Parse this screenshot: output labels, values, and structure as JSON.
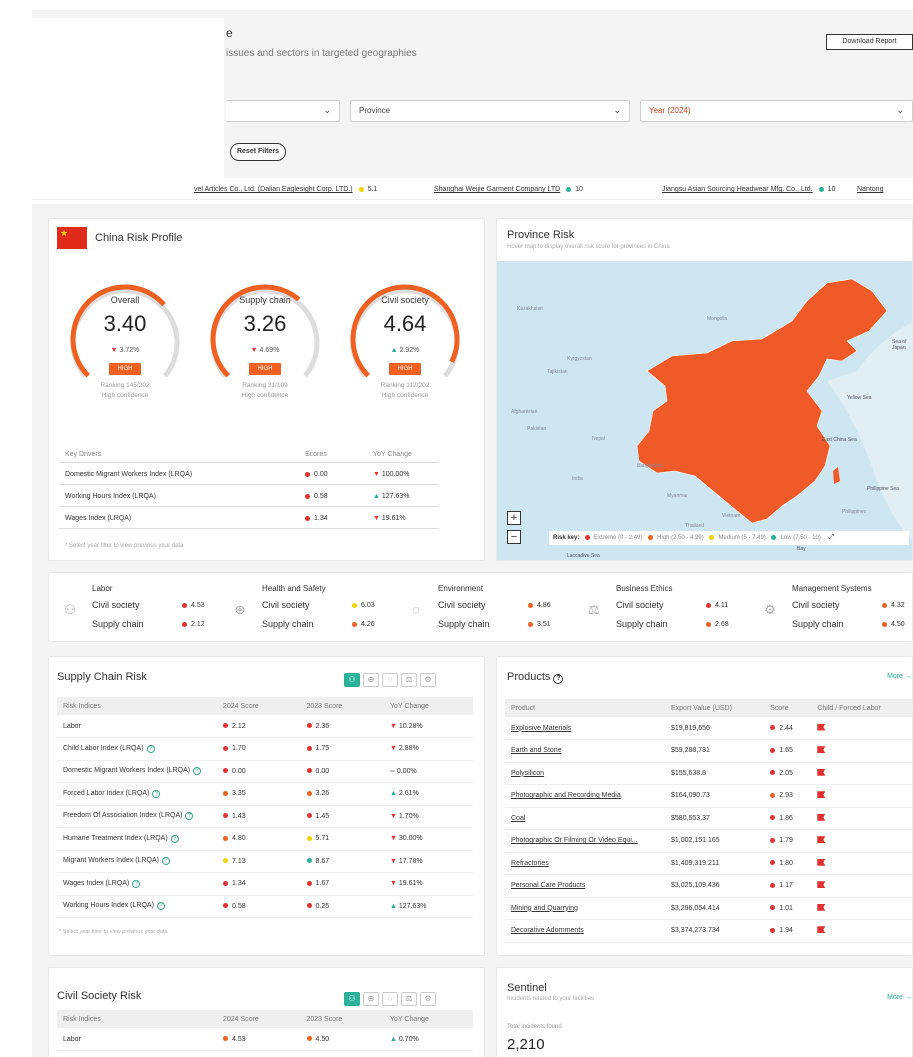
{
  "header": {
    "title_fragment": "e",
    "subtitle": "issues and sectors in targeted geographies",
    "download_label": "Download Report"
  },
  "filters": {
    "country_value": "",
    "province_value": "Province",
    "year_value": "Year (2024)",
    "reset_label": "Reset Filters"
  },
  "ticker": [
    {
      "name": "vel Articles Co., Ltd. (Dalian Eaglesight Corp. LTD.)",
      "score": "5.1",
      "color": "#f2d200"
    },
    {
      "name": "Shanghai Weijie Garment Company LTD",
      "score": "10",
      "color": "#2bb19a"
    },
    {
      "name": "Jiangsu Asian Sourcing Headwear Mfg. Co., Ltd.",
      "score": "10",
      "color": "#2bb19a"
    },
    {
      "name": "Nantong",
      "score": "",
      "color": ""
    }
  ],
  "profile": {
    "title": "China Risk Profile",
    "gauges": [
      {
        "label": "Overall",
        "score": "3.40",
        "change": "3.72%",
        "dir": "down",
        "badge": "HIGH",
        "rank": "Ranking 145/202",
        "conf": "High confidence",
        "level": 0.68
      },
      {
        "label": "Supply chain",
        "score": "3.26",
        "change": "4.69%",
        "dir": "down",
        "badge": "HIGH",
        "rank": "Ranking 31/109",
        "conf": "High confidence",
        "level": 0.65
      },
      {
        "label": "Civil society",
        "score": "4.64",
        "change": "2.92%",
        "dir": "up",
        "badge": "HIGH",
        "rank": "Ranking 112/202",
        "conf": "High confidence",
        "level": 0.93
      }
    ],
    "drivers_headers": [
      "Key Drivers",
      "Scores",
      "YoY Change"
    ],
    "drivers": [
      {
        "name": "Domestic Migrant Workers Index (LRQA)",
        "score": "0.00",
        "change": "100.00%",
        "dir": "down"
      },
      {
        "name": "Working Hours Index (LRQA)",
        "score": "0.58",
        "change": "127.63%",
        "dir": "up"
      },
      {
        "name": "Wages Index (LRQA)",
        "score": "1.34",
        "change": "19.61%",
        "dir": "down"
      }
    ],
    "note": "* Select year filter to view previous year data"
  },
  "province": {
    "title": "Province Risk",
    "subtitle": "Hover map to display overall risk score for provinces in China",
    "risk_key_label": "Risk key:",
    "risk_key": [
      {
        "label": "Extreme (0 - 2.49)",
        "color": "#e53030"
      },
      {
        "label": "High (2.50 - 4.99)",
        "color": "#f06020"
      },
      {
        "label": "Medium (5 - 7.49)",
        "color": "#f2d200"
      },
      {
        "label": "Low (7.50 - 10)",
        "color": "#2bb19a"
      }
    ],
    "zoom_in": "+",
    "zoom_out": "−",
    "map_labels": [
      "Kazakhstan",
      "Mongolia",
      "Kyrgyzstan",
      "Tajikistan",
      "Afghanistan",
      "Pakistan",
      "Nepal",
      "Bangladesh",
      "Myanmar",
      "Thailand",
      "Vietnam",
      "Yellow Sea",
      "East China Sea",
      "Philippine Sea",
      "Sea of Japan",
      "Laccadive Sea",
      "Bay",
      "India",
      "Philippines"
    ]
  },
  "categories": [
    {
      "title": "Labor",
      "icon": "labor-icon",
      "civil": "4.53",
      "civil_color": "#e53030",
      "supply": "2.12",
      "supply_color": "#e53030"
    },
    {
      "title": "Health and Safety",
      "icon": "health-safety-icon",
      "civil": "6.03",
      "civil_color": "#f2d200",
      "supply": "4.26",
      "supply_color": "#f06020"
    },
    {
      "title": "Environment",
      "icon": "environment-icon",
      "civil": "4.86",
      "civil_color": "#f06020",
      "supply": "3.51",
      "supply_color": "#f06020"
    },
    {
      "title": "Business Ethics",
      "icon": "business-ethics-icon",
      "civil": "4.11",
      "civil_color": "#e53030",
      "supply": "2.68",
      "supply_color": "#f06020"
    },
    {
      "title": "Management Systems",
      "icon": "management-systems-icon",
      "civil": "4.32",
      "civil_color": "#f06020",
      "supply": "4.50",
      "supply_color": "#f06020"
    }
  ],
  "category_row_labels": {
    "civil": "Civil society",
    "supply": "Supply chain"
  },
  "supply_chain": {
    "title": "Supply Chain Risk",
    "headers": [
      "Risk Indices",
      "2024 Score",
      "2023 Score",
      "YoY Change"
    ],
    "rows": [
      {
        "name": "Labor",
        "help": false,
        "s24": "2.12",
        "c24": "#e53030",
        "s23": "2.36",
        "c23": "#e53030",
        "change": "10.28%",
        "dir": "down"
      },
      {
        "name": "Child Labor Index (LRQA)",
        "help": true,
        "s24": "1.70",
        "c24": "#e53030",
        "s23": "1.75",
        "c23": "#e53030",
        "change": "2.88%",
        "dir": "down"
      },
      {
        "name": "Domestic Migrant Workers Index (LRQA)",
        "help": true,
        "s24": "0.00",
        "c24": "#e53030",
        "s23": "0.00",
        "c23": "#e53030",
        "change": "0.00%",
        "dir": "flat"
      },
      {
        "name": "Forced Labor Index (LRQA)",
        "help": true,
        "s24": "3.35",
        "c24": "#f06020",
        "s23": "3.26",
        "c23": "#f06020",
        "change": "2.61%",
        "dir": "up"
      },
      {
        "name": "Freedom Of Association Index (LRQA)",
        "help": true,
        "s24": "1.43",
        "c24": "#e53030",
        "s23": "1.45",
        "c23": "#e53030",
        "change": "1.70%",
        "dir": "down"
      },
      {
        "name": "Humane Treatment Index (LRQA)",
        "help": true,
        "s24": "4.80",
        "c24": "#f06020",
        "s23": "5.71",
        "c23": "#f2d200",
        "change": "30.00%",
        "dir": "down"
      },
      {
        "name": "Migrant Workers Index (LRQA)",
        "help": true,
        "s24": "7.13",
        "c24": "#f2d200",
        "s23": "8.67",
        "c23": "#2bb19a",
        "change": "17.78%",
        "dir": "down"
      },
      {
        "name": "Wages Index (LRQA)",
        "help": true,
        "s24": "1.34",
        "c24": "#e53030",
        "s23": "1.67",
        "c23": "#e53030",
        "change": "19.61%",
        "dir": "down"
      },
      {
        "name": "Working Hours Index (LRQA)",
        "help": true,
        "s24": "0.58",
        "c24": "#e53030",
        "s23": "0.25",
        "c23": "#e53030",
        "change": "127.63%",
        "dir": "up"
      }
    ],
    "note": "* Select year filter to view previous year data"
  },
  "products": {
    "title": "Products",
    "more": "More →",
    "headers": [
      "Product",
      "Export Value (USD)",
      "Score",
      "Child / Forced Labor"
    ],
    "rows": [
      {
        "name": "Explosive Materials",
        "value": "$19,819,656",
        "score": "2.44",
        "color": "#e53030"
      },
      {
        "name": "Earth and Stone",
        "value": "$59,288,731",
        "score": "1.65",
        "color": "#e53030"
      },
      {
        "name": "Polysilicon",
        "value": "$155,638.8",
        "score": "2.05",
        "color": "#e53030"
      },
      {
        "name": "Photographic and Recording Media",
        "value": "$164,090.73",
        "score": "2.93",
        "color": "#f06020"
      },
      {
        "name": "Coal",
        "value": "$580,553.37",
        "score": "1.86",
        "color": "#e53030"
      },
      {
        "name": "Photographic Or Filming Or Video Equi...",
        "value": "$1,002,151.165",
        "score": "1.79",
        "color": "#e53030"
      },
      {
        "name": "Refractories",
        "value": "$1,409,319.211",
        "score": "1.80",
        "color": "#e53030"
      },
      {
        "name": "Personal Care Products",
        "value": "$3,025,109.436",
        "score": "1.17",
        "color": "#e53030"
      },
      {
        "name": "Mining and Quarrying",
        "value": "$3,296,054.414",
        "score": "1.01",
        "color": "#e53030"
      },
      {
        "name": "Decorative Adornments",
        "value": "$3,374,273.734",
        "score": "1.94",
        "color": "#e53030"
      }
    ]
  },
  "civil_society": {
    "title": "Civil Society Risk",
    "headers": [
      "Risk Indices",
      "2024 Score",
      "2023 Score",
      "YoY Change"
    ],
    "rows": [
      {
        "name": "Labor",
        "s24": "4.53",
        "c24": "#f06020",
        "s23": "4.50",
        "c23": "#f06020",
        "change": "0.70%",
        "dir": "up"
      }
    ]
  },
  "sentinel": {
    "title": "Sentinel",
    "subtitle": "Incidents related to your facilities",
    "more": "More →",
    "count_label": "Total incidents found",
    "count": "2,210"
  },
  "colors": {
    "accent": "#2bb19a",
    "high": "#f06020",
    "extreme": "#e53030",
    "map_fill": "#f05a28",
    "map_water": "#c9e6f2"
  }
}
